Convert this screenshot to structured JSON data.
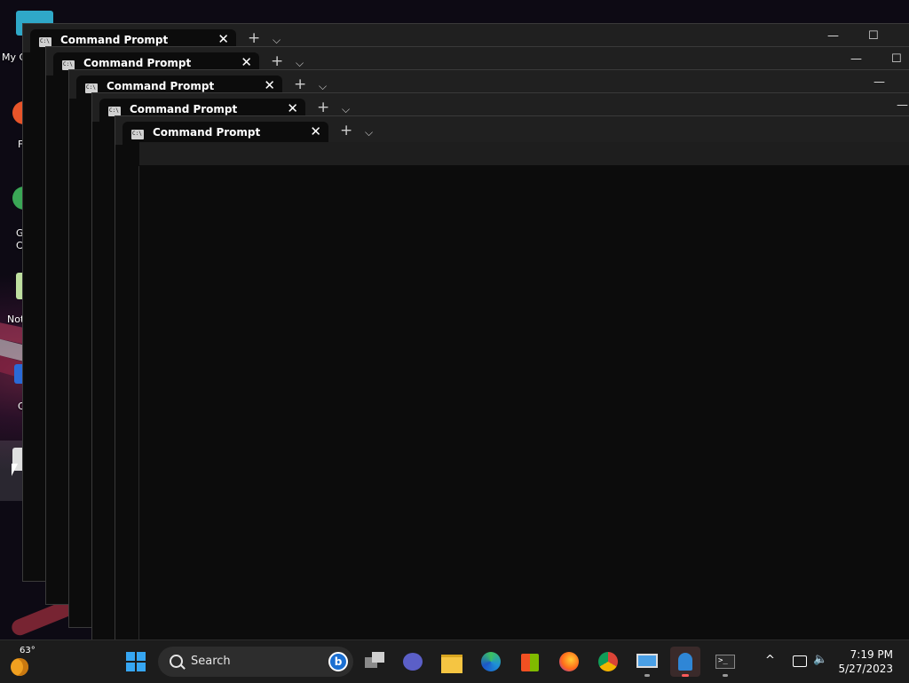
{
  "desktop": {
    "icons": [
      {
        "label": "My C"
      },
      {
        "label": "F"
      },
      {
        "label": "G"
      },
      {
        "label": "C"
      },
      {
        "label": "Not"
      },
      {
        "label": "C"
      }
    ]
  },
  "windows": [
    {
      "tab_title": "Command Prompt"
    },
    {
      "tab_title": "Command Prompt"
    },
    {
      "tab_title": "Command Prompt"
    },
    {
      "tab_title": "Command Prompt"
    },
    {
      "tab_title": "Command Prompt"
    }
  ],
  "taskbar": {
    "weather_temp": "63°",
    "search_placeholder": "Search",
    "clock_time": "7:19 PM",
    "clock_date": "5/27/2023",
    "icons": [
      "start-icon",
      "task-view-icon",
      "teams-chat-icon",
      "file-explorer-icon",
      "edge-icon",
      "store-icon",
      "firefox-icon",
      "chrome-icon",
      "remote-desktop-icon",
      "app-icon",
      "terminal-icon"
    ]
  },
  "colors": {
    "accent": "#0078d4",
    "window_bg": "#0c0c0c",
    "titlebar": "#202020"
  }
}
